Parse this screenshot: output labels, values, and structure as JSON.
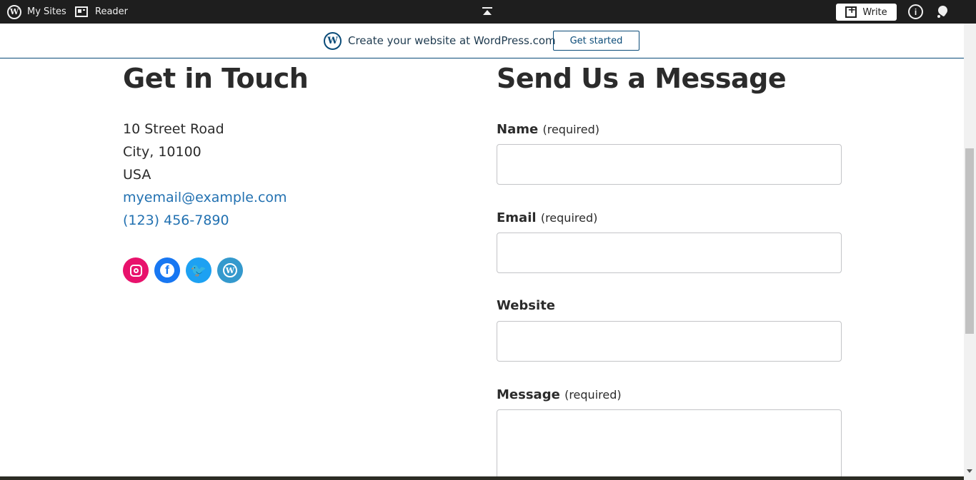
{
  "adminbar": {
    "my_sites": "My Sites",
    "reader": "Reader",
    "write": "Write",
    "wp_glyph": "W",
    "help_glyph": "i"
  },
  "banner": {
    "text": "Create your website at WordPress.com",
    "button": "Get started",
    "logo_glyph": "W"
  },
  "contact": {
    "heading": "Get in Touch",
    "address_line1": "10 Street Road",
    "address_line2": "City, 10100",
    "country": "USA",
    "email": "myemail@example.com",
    "phone": "(123) 456-7890",
    "social": [
      {
        "icon": "instagram-icon",
        "color": "#e8126c"
      },
      {
        "icon": "facebook-icon",
        "color": "#1877f2",
        "glyph": "f"
      },
      {
        "icon": "twitter-icon",
        "color": "#1da1f2",
        "glyph": "🐦"
      },
      {
        "icon": "wordpress-icon",
        "color": "#3499cd",
        "glyph": "W"
      }
    ]
  },
  "form": {
    "heading": "Send Us a Message",
    "fields": [
      {
        "label": "Name",
        "required": "(required)"
      },
      {
        "label": "Email",
        "required": "(required)"
      },
      {
        "label": "Website",
        "required": ""
      },
      {
        "label": "Message",
        "required": "(required)"
      }
    ]
  }
}
